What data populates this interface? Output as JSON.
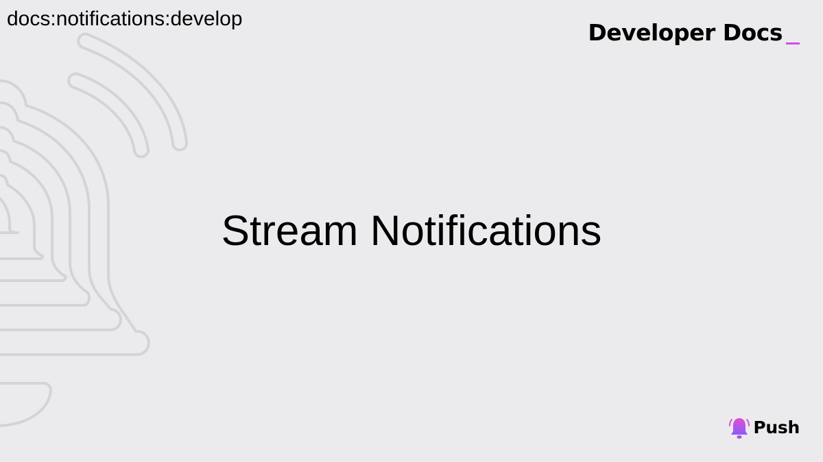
{
  "header": {
    "breadcrumb": "docs:notifications:develop",
    "brand_title": "Developer Docs"
  },
  "main": {
    "title": "Stream Notifications"
  },
  "footer": {
    "logo_label": "Push"
  },
  "colors": {
    "background": "#ebebed",
    "accent": "#d548ec",
    "illustration_stroke": "#d4d3da"
  },
  "icons": {
    "background_art": "bell-ringing-outline",
    "logo": "bell-icon"
  }
}
